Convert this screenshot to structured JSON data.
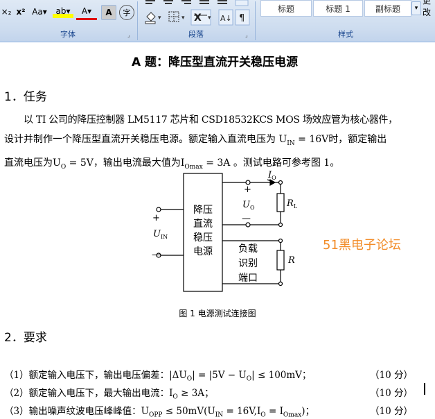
{
  "ribbon": {
    "font_group": {
      "label": "字体",
      "buttons": [
        "×₂",
        "x²",
        "Aa▾",
        "ab▾",
        "A▾",
        "A",
        "字"
      ]
    },
    "paragraph_group": {
      "label": "段落"
    },
    "styles_group": {
      "label": "样式",
      "styles": [
        "标题",
        "标题 1",
        "副标题"
      ],
      "more_label": "更改"
    }
  },
  "document": {
    "title": "A 题：降压型直流开关稳压电源",
    "section1": "1．任务",
    "para1_line1": "以 TI 公司的降压控制器 LM5117 芯片和 CSD18532KCS MOS 场效应管为核心器件，",
    "para1_line2": "设计并制作一个降压型直流开关稳压电源。额定输入直流电压为 U",
    "para1_line2_sub": "IN",
    "para1_line2_tail": " = 16V时，额定输出",
    "para1_line3": "直流电压为U",
    "para1_line3_sub": "O",
    "para1_line3_mid": " = 5V，输出电流最大值为I",
    "para1_line3_sub2": "Omax",
    "para1_line3_tail": " = 3A 。测试电路可参考图 1。",
    "figure": {
      "box_text": [
        "降压",
        "直流",
        "稳压",
        "电源"
      ],
      "load_text": [
        "负载",
        "识别",
        "端口"
      ],
      "io_label": "I",
      "io_sub": "O",
      "uo_label": "U",
      "uo_sub": "O",
      "uin_label": "U",
      "uin_sub": "IN",
      "rl_label": "R",
      "rl_sub": "L",
      "r_label": "R",
      "plus": "+",
      "minus": "—",
      "caption": "图 1    电源测试连接图"
    },
    "watermark": "51黑电子论坛",
    "section2": "2．要求",
    "requirements": [
      {
        "text": "（1）额定输入电压下，输出电压偏差：|ΔU",
        "sub": "O",
        "tail": "| = |5V − U",
        "sub2": "O",
        "tail2": "| ≤ 100mV；",
        "score": "（10 分）"
      },
      {
        "text": "（2）额定输入电压下，最大输出电流：I",
        "sub": "O",
        "tail": " ≥ 3A；",
        "sub2": "",
        "tail2": "",
        "score": "（10 分）"
      },
      {
        "text": "（3）输出噪声纹波电压峰峰值：U",
        "sub": "OPP",
        "tail": " ≤ 50mV(U",
        "sub2": "IN",
        "tail2": " = 16V,I",
        "sub3": "O",
        "tail3": " = I",
        "sub4": "Omax",
        "tail4": ")；",
        "score": "（10 分）"
      }
    ]
  },
  "colors": {
    "ribbon_bg": "#cddcef",
    "group_label": "#15428b",
    "watermark": "#f28c28"
  }
}
